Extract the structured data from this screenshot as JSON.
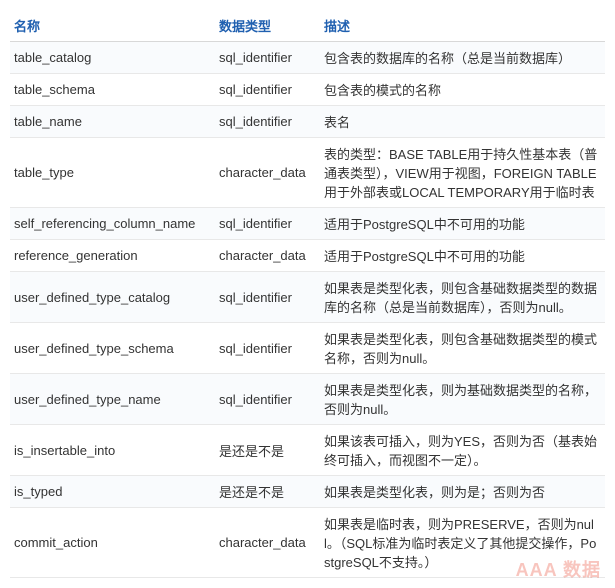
{
  "headers": {
    "name": "名称",
    "dtype": "数据类型",
    "desc": "描述"
  },
  "rows": [
    {
      "name": "table_catalog",
      "dtype": "sql_identifier",
      "desc": "包含表的数据库的名称（总是当前数据库）"
    },
    {
      "name": "table_schema",
      "dtype": "sql_identifier",
      "desc": "包含表的模式的名称"
    },
    {
      "name": "table_name",
      "dtype": "sql_identifier",
      "desc": "表名"
    },
    {
      "name": "table_type",
      "dtype": "character_data",
      "desc": "表的类型：BASE TABLE用于持久性基本表（普通表类型），VIEW用于视图，FOREIGN TABLE用于外部表或LOCAL TEMPORARY用于临时表"
    },
    {
      "name": "self_referencing_column_name",
      "dtype": "sql_identifier",
      "desc": "适用于PostgreSQL中不可用的功能"
    },
    {
      "name": "reference_generation",
      "dtype": "character_data",
      "desc": "适用于PostgreSQL中不可用的功能"
    },
    {
      "name": "user_defined_type_catalog",
      "dtype": "sql_identifier",
      "desc": "如果表是类型化表，则包含基础数据类型的数据库的名称（总是当前数据库），否则为null。"
    },
    {
      "name": "user_defined_type_schema",
      "dtype": "sql_identifier",
      "desc": "如果表是类型化表，则包含基础数据类型的模式名称，否则为null。"
    },
    {
      "name": "user_defined_type_name",
      "dtype": "sql_identifier",
      "desc": "如果表是类型化表，则为基础数据类型的名称，否则为null。"
    },
    {
      "name": "is_insertable_into",
      "dtype": "是还是不是",
      "desc": "如果该表可插入，则为YES，否则为否（基表始终可插入，而视图不一定）。"
    },
    {
      "name": "is_typed",
      "dtype": "是还是不是",
      "desc": "如果表是类型化表，则为是；否则为否"
    },
    {
      "name": "commit_action",
      "dtype": "character_data",
      "desc": "如果表是临时表，则为PRESERVE，否则为null。（SQL标准为临时表定义了其他提交操作，PostgreSQL不支持。）"
    }
  ],
  "watermark": "AAA 数据"
}
